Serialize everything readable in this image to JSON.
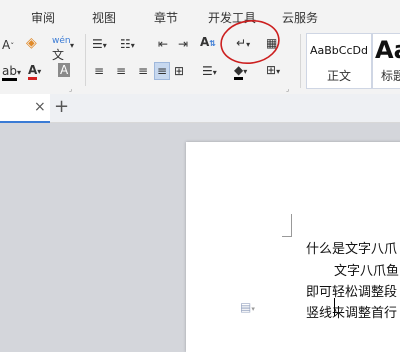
{
  "menu": {
    "items": [
      "审阅",
      "视图",
      "章节",
      "开发工具",
      "云服务"
    ]
  },
  "ribbon": {
    "font_size_label": "A",
    "pinyin_label": "wén",
    "pinyin_glyph": "文",
    "sort_label": "A",
    "styles": [
      {
        "preview": "AaBbCcDd",
        "name": "正文"
      },
      {
        "preview": "Aa",
        "name": "标题"
      }
    ],
    "font_color_label": "A",
    "char_shade_label": "A",
    "accent": "#3a7bd5",
    "annotation_color": "#cc1f1f"
  },
  "tabs": {
    "close": "×",
    "add": "+"
  },
  "document": {
    "lines": [
      "什么是文字八爪",
      "文字八爪鱼",
      "即可轻松调整段",
      "竖线来调整首行"
    ]
  }
}
